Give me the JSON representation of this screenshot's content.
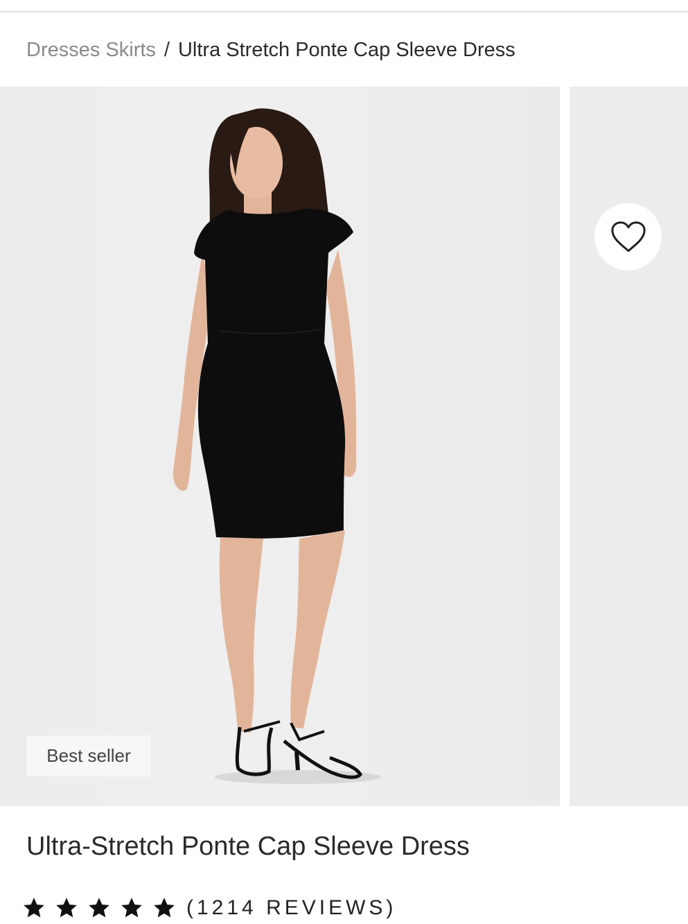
{
  "breadcrumb": {
    "category": "Dresses Skirts",
    "separator": "/",
    "current": "Ultra Stretch Ponte Cap Sleeve Dress"
  },
  "gallery": {
    "badge": "Best seller",
    "favorite_icon": "heart-outline-icon"
  },
  "product": {
    "title": "Ultra-Stretch Ponte Cap Sleeve Dress",
    "rating": {
      "stars": 5,
      "max": 5,
      "reviews_label": "(1214 REVIEWS)"
    }
  },
  "colors": {
    "page_bg": "#ffffff",
    "photo_bg": "#ececec",
    "dress": "#0d0d0d",
    "skin": "#e2b59a",
    "hair": "#2a1a14",
    "star": "#111111",
    "breadcrumb_muted": "#8a8a8a"
  }
}
